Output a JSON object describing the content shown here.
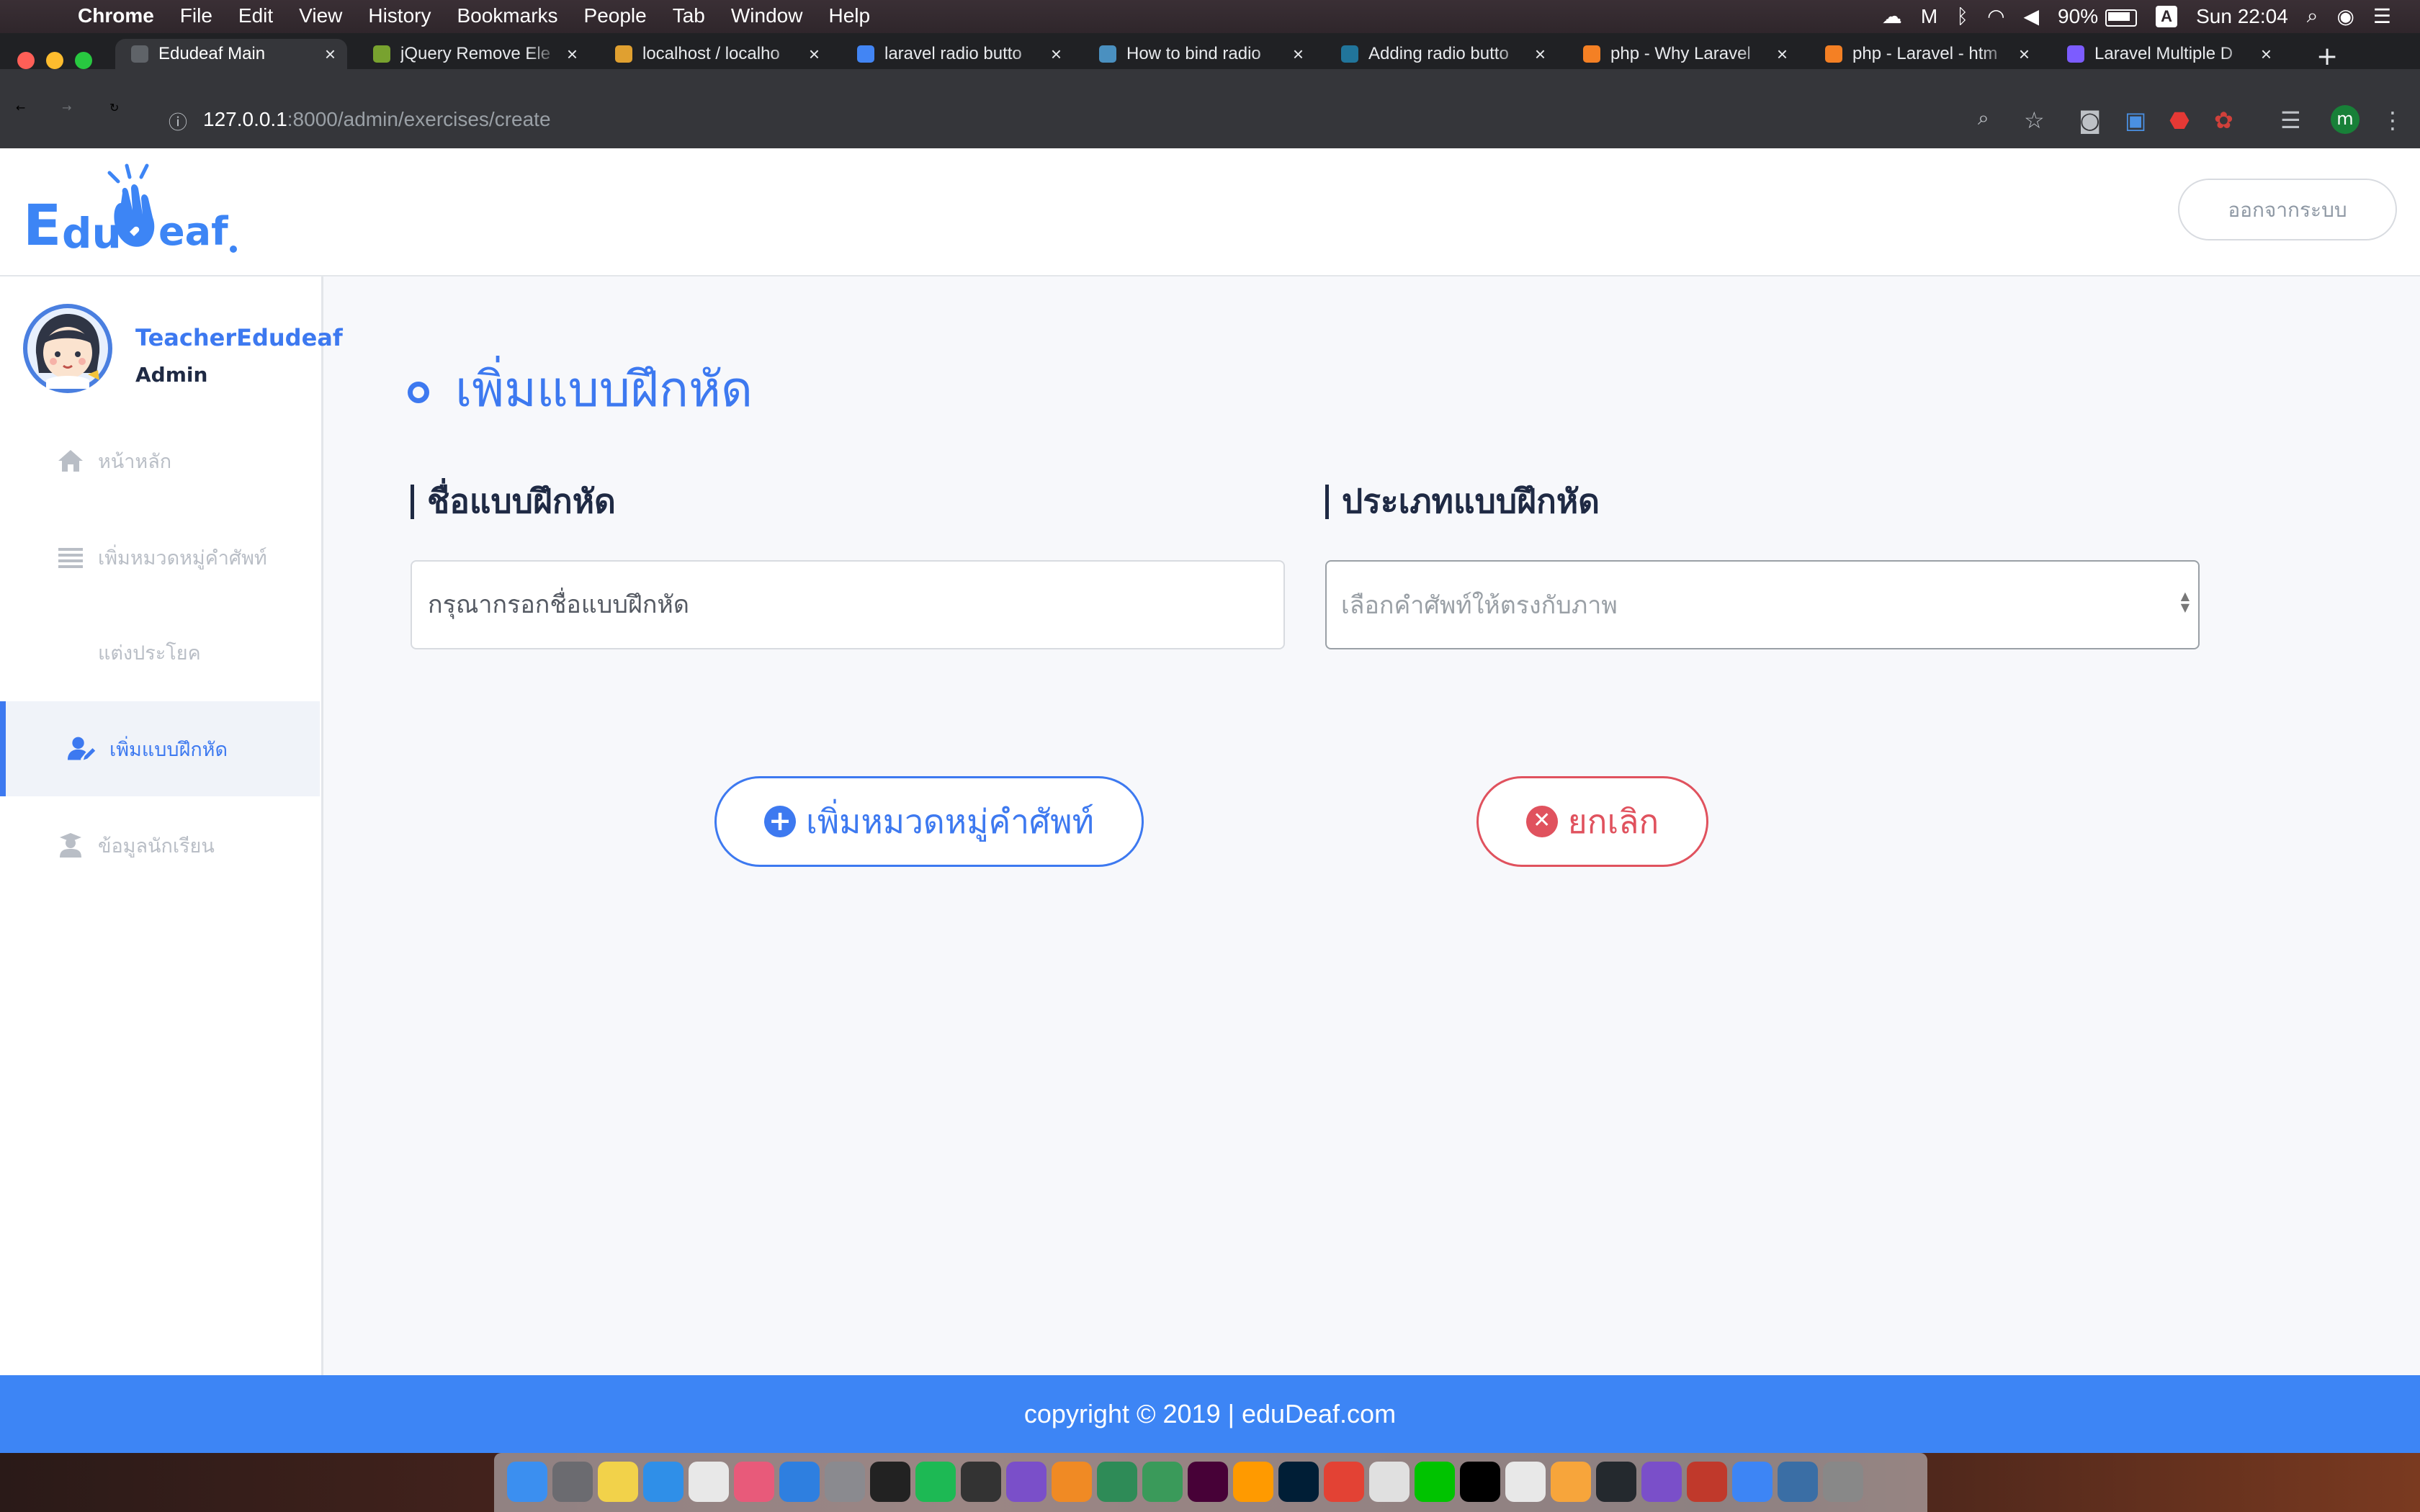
{
  "menubar": {
    "app": "Chrome",
    "items": [
      "File",
      "Edit",
      "View",
      "History",
      "Bookmarks",
      "People",
      "Tab",
      "Window",
      "Help"
    ],
    "battery": "90%",
    "input_indicator": "A",
    "clock": "Sun 22:04"
  },
  "browser": {
    "tabs": [
      {
        "title": "Edudeaf Main",
        "fav_color": "#5f6368"
      },
      {
        "title": "jQuery Remove Ele",
        "fav_color": "#78a22f"
      },
      {
        "title": "localhost / localho",
        "fav_color": "#e0a030"
      },
      {
        "title": "laravel radio butto",
        "fav_color": "#4285f4"
      },
      {
        "title": "How to bind radio",
        "fav_color": "#4a90c0"
      },
      {
        "title": "Adding radio butto",
        "fav_color": "#21759b"
      },
      {
        "title": "php - Why Laravel",
        "fav_color": "#f48024"
      },
      {
        "title": "php - Laravel - htm",
        "fav_color": "#f48024"
      },
      {
        "title": "Laravel Multiple D",
        "fav_color": "#7c5cff"
      }
    ],
    "url_host": "127.0.0.1",
    "url_path": ":8000/admin/exercises/create",
    "profile_initial": "m"
  },
  "header": {
    "logo_text": "EduDeaf",
    "logout_label": "ออกจากระบบ"
  },
  "sidebar": {
    "user_name": "TeacherEdudeaf",
    "user_role": "Admin",
    "items": [
      {
        "label": "หน้าหลัก",
        "icon": "home-icon"
      },
      {
        "label": "เพิ่มหมวดหมู่คำศัพท์",
        "icon": "list-icon"
      },
      {
        "label": "แต่งประโยค",
        "icon": ""
      },
      {
        "label": "เพิ่มแบบฝึกหัด",
        "icon": "user-edit-icon"
      },
      {
        "label": "ข้อมูลนักเรียน",
        "icon": "graduate-icon"
      }
    ]
  },
  "main": {
    "title": "เพิ่มแบบฝึกหัด",
    "name_label": "ชื่อแบบฝึกหัด",
    "name_placeholder": "กรุณากรอกชื่อแบบฝึกหัด",
    "type_label": "ประเภทแบบฝึกหัด",
    "type_selected": "เลือกคำศัพท์ให้ตรงกับภาพ",
    "add_button": "เพิ่มหมวดหมู่คำศัพท์",
    "cancel_button": "ยกเลิก"
  },
  "footer": {
    "text": "copyright © 2019 | eduDeaf.com"
  },
  "colors": {
    "accent": "#3d79f0",
    "danger": "#e0525e",
    "footer": "#3d85f5",
    "heading": "#1f2a44"
  }
}
